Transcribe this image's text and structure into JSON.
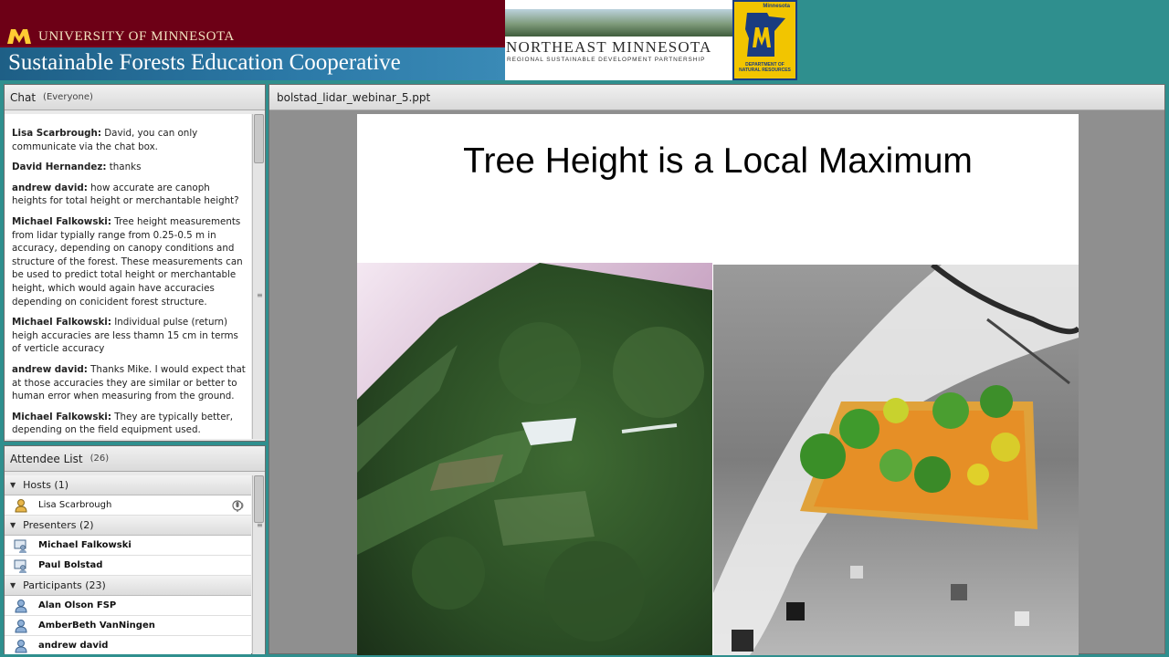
{
  "header": {
    "university": "UNIVERSITY OF MINNESOTA",
    "coop_title": "Sustainable Forests Education Cooperative",
    "nemn_title": "NORTHEAST MINNESOTA",
    "nemn_subtitle": "REGIONAL SUSTAINABLE DEVELOPMENT PARTNERSHIP",
    "dnr_top": "Minnesota",
    "dnr_bottom": "DEPARTMENT OF NATURAL RESOURCES"
  },
  "chat": {
    "title": "Chat",
    "audience": "(Everyone)",
    "messages": [
      {
        "name": "Lisa  Scarbrough:",
        "text": " David, you can only communicate via the chat box."
      },
      {
        "name": "David Hernandez:",
        "text": " thanks"
      },
      {
        "name": "andrew david:",
        "text": " how accurate are canoph heights for total height or merchantable height?"
      },
      {
        "name": "Michael Falkowski:",
        "text": " Tree height measurements from lidar typially range from 0.25-0.5 m in accuracy, depending on canopy conditions and structure of the forest. These measurements can be used to predict total height or merchantable height, which would again have accuracies depending on conicident forest structure."
      },
      {
        "name": "Michael Falkowski:",
        "text": " Individual pulse (return) heigh accuracies are less thamn 15 cm in terms of verticle accuracy"
      },
      {
        "name": "andrew david:",
        "text": " Thanks Mike.  I would expect that at those accuracies they are similar or better to human error when measuring from the ground."
      },
      {
        "name": "Michael Falkowski:",
        "text": " They are typically better, depending on the field equipment used."
      }
    ]
  },
  "attendees": {
    "title": "Attendee List",
    "count": "(26)",
    "hosts_label": "Hosts (1)",
    "hosts": [
      "Lisa  Scarbrough"
    ],
    "presenters_label": "Presenters (2)",
    "presenters": [
      "Michael Falkowski",
      "Paul Bolstad"
    ],
    "participants_label": "Participants (23)",
    "participants": [
      "Alan Olson FSP",
      "AmberBeth VanNingen",
      "andrew david"
    ]
  },
  "slide": {
    "filename": "bolstad_lidar_webinar_5.ppt",
    "title": "Tree Height is a Local Maximum"
  },
  "colors": {
    "background": "#2f8f8e",
    "umn_maroon": "#7a0019",
    "umn_gold": "#f1e3c0",
    "dnr_yellow": "#f2c500"
  }
}
